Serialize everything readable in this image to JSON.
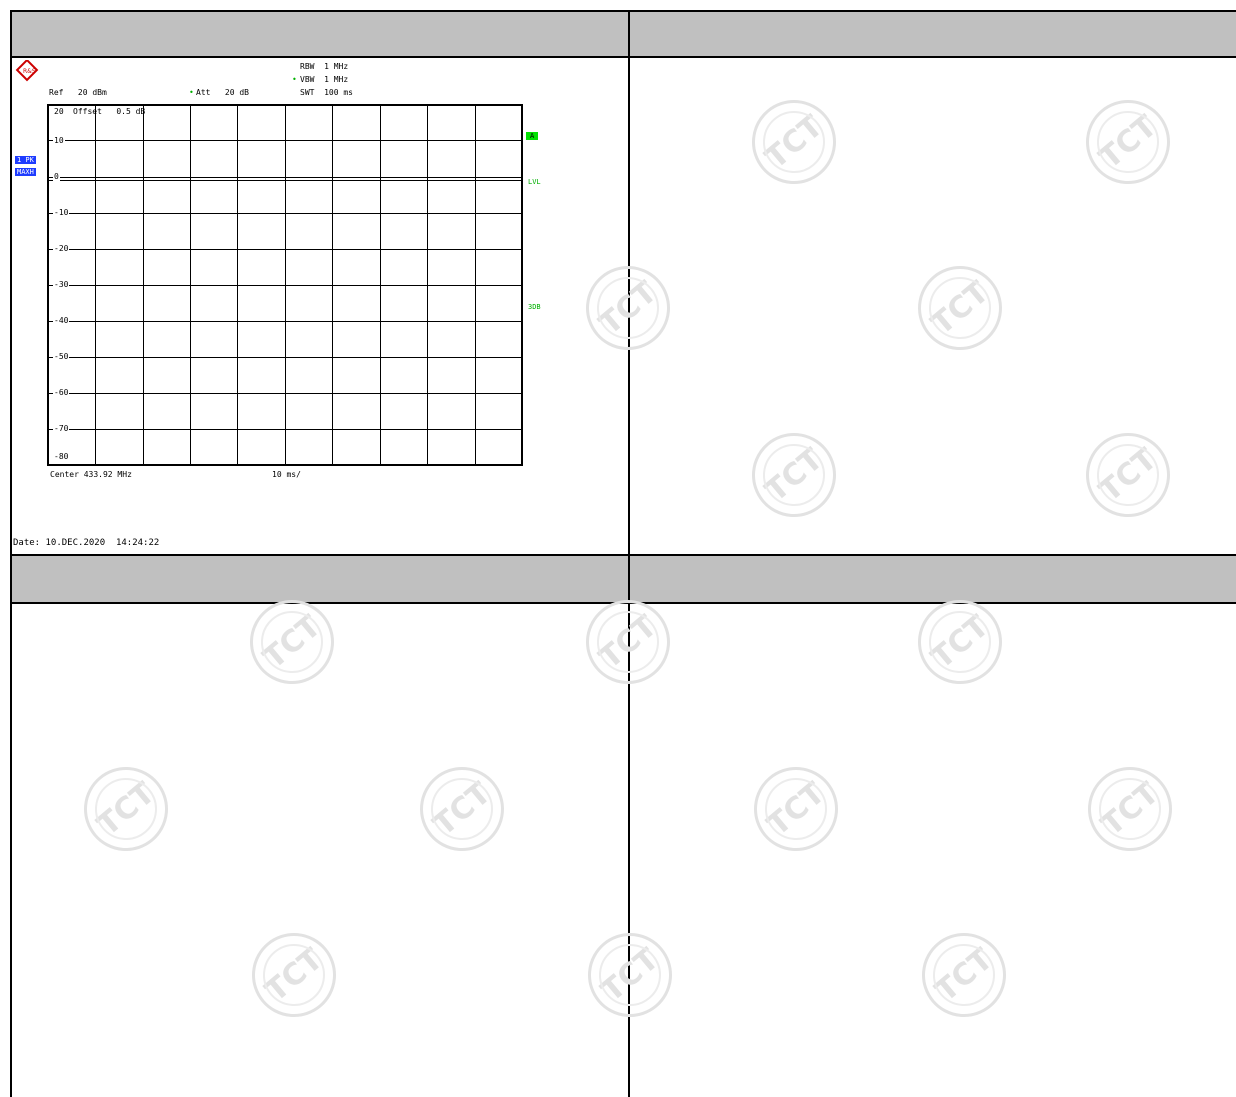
{
  "watermark": {
    "text": "TCT"
  },
  "analyzer": {
    "logo": "R&S",
    "ref": "Ref   20 dBm",
    "att": "Att   20 dB",
    "rbw": "RBW  1 MHz",
    "vbw": "VBW  1 MHz",
    "swt": "SWT  100 ms",
    "offset": "Offset   0.5 dB",
    "trace_badge": "1 PK",
    "mode_badge": "MAXH",
    "marker_a": "A",
    "lvl_label": "LVL",
    "db3_label": "3DB",
    "center": "Center 433.92 MHz",
    "span": "10 ms/",
    "date": "Date: 10.DEC.2020  14:24:22",
    "y_ticks": [
      "20",
      "10",
      "0",
      "-10",
      "-20",
      "-30",
      "-40",
      "-50",
      "-60",
      "-70",
      "-80"
    ],
    "accent_color": "#00e000",
    "badge_color": "#1e3cff"
  }
}
